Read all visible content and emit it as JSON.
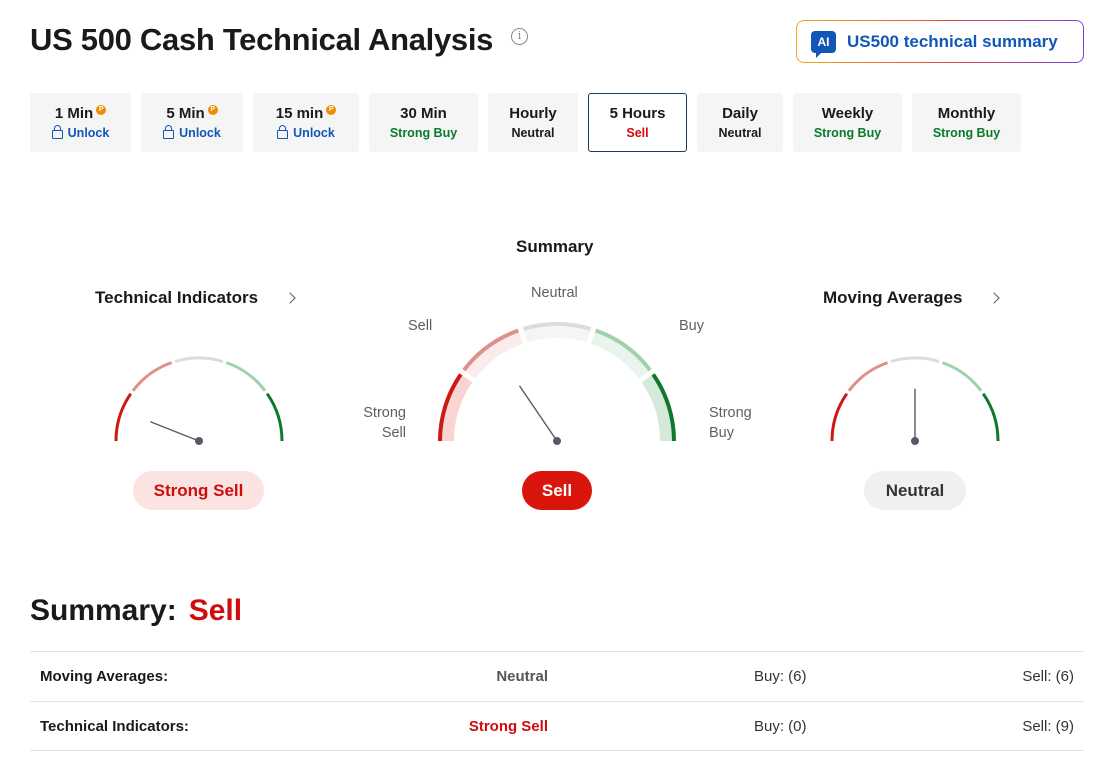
{
  "header": {
    "title": "US 500 Cash Technical Analysis",
    "info_symbol": "i",
    "ai_badge": "AI",
    "ai_button_label": "US500 technical summary"
  },
  "timeframes": [
    {
      "label": "1 Min",
      "status": "Unlock",
      "locked": true,
      "pro_badge": "P"
    },
    {
      "label": "5 Min",
      "status": "Unlock",
      "locked": true,
      "pro_badge": "P"
    },
    {
      "label": "15 min",
      "status": "Unlock",
      "locked": true,
      "pro_badge": "P"
    },
    {
      "label": "30 Min",
      "status": "Strong Buy"
    },
    {
      "label": "Hourly",
      "status": "Neutral"
    },
    {
      "label": "5 Hours",
      "status": "Sell",
      "active": true
    },
    {
      "label": "Daily",
      "status": "Neutral"
    },
    {
      "label": "Weekly",
      "status": "Strong Buy"
    },
    {
      "label": "Monthly",
      "status": "Strong Buy"
    }
  ],
  "gauges": {
    "summary": {
      "title": "Summary",
      "labels": {
        "strong_sell": "Strong\nSell",
        "sell": "Sell",
        "neutral": "Neutral",
        "buy": "Buy",
        "strong_buy": "Strong\nBuy"
      },
      "reading": "Sell",
      "needle_level": 0.31
    },
    "technical_indicators": {
      "title": "Technical Indicators",
      "reading": "Strong Sell",
      "needle_level": 0.12
    },
    "moving_averages": {
      "title": "Moving Averages",
      "reading": "Neutral",
      "needle_level": 0.5
    }
  },
  "summary": {
    "heading": "Summary:",
    "value": "Sell",
    "rows": [
      {
        "name": "Moving Averages:",
        "signal": "Neutral",
        "buy": "Buy: (6)",
        "sell": "Sell: (6)"
      },
      {
        "name": "Technical Indicators:",
        "signal": "Strong Sell",
        "buy": "Buy: (0)",
        "sell": "Sell: (9)"
      }
    ]
  },
  "colors": {
    "strong_sell": "#cc1a13",
    "sell": "#de918b",
    "neutral": "#dcdcdc",
    "buy": "#9ed2ac",
    "strong_buy": "#10782d",
    "needle": "#555b66",
    "accent_blue": "#1256b8"
  }
}
